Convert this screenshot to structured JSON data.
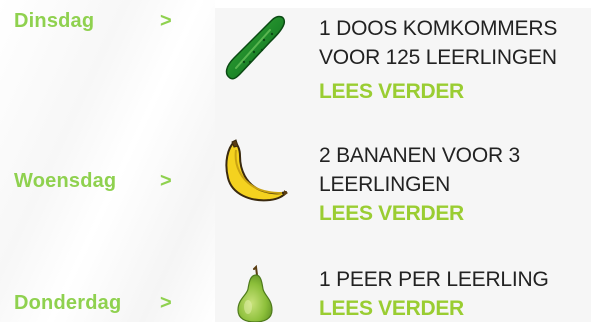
{
  "schedule": [
    {
      "day": "Dinsdag",
      "arrow": ">",
      "icon": "cucumber-icon",
      "text_lines": [
        "1 DOOS KOMKOMMERS",
        "VOOR 125 LEERLINGEN"
      ],
      "read_more": "LEES VERDER"
    },
    {
      "day": "Woensdag",
      "arrow": ">",
      "icon": "banana-icon",
      "text_lines": [
        "2 BANANEN VOOR 3",
        "LEERLINGEN"
      ],
      "read_more": "LEES VERDER"
    },
    {
      "day": "Donderdag",
      "arrow": ">",
      "icon": "pear-icon",
      "text_lines": [
        "1 PEER PER LEERLING"
      ],
      "read_more": "LEES VERDER"
    }
  ],
  "colors": {
    "day_link": "#8fd14f",
    "read_more": "#9acd32",
    "item_text": "#222222",
    "panel_bg": "#f6f6f6"
  }
}
